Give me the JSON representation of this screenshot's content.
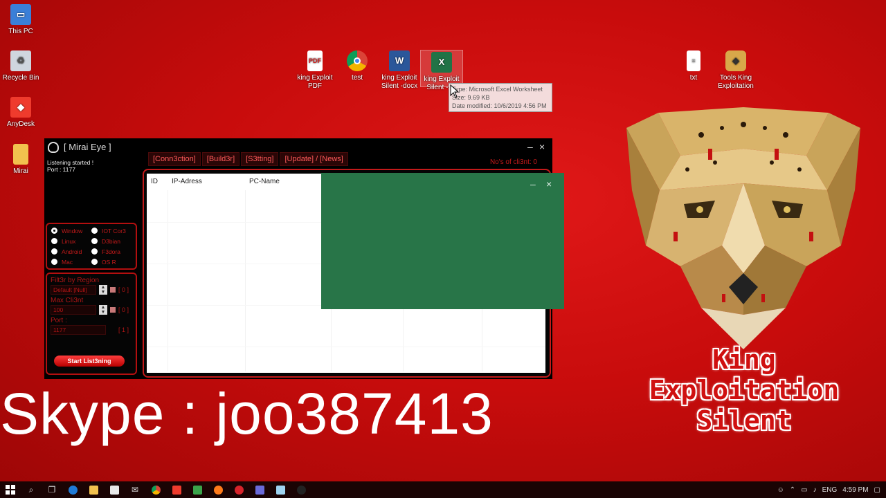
{
  "desktop": {
    "left_icons": [
      {
        "label": "This PC",
        "icon": "computer-icon"
      },
      {
        "label": "Recycle Bin",
        "icon": "recycle-bin-icon"
      },
      {
        "label": "AnyDesk",
        "icon": "anydesk-icon"
      },
      {
        "label": "Mirai",
        "icon": "folder-icon"
      }
    ],
    "top_icons": [
      {
        "label": "king Exploit PDF",
        "icon": "pdf-icon"
      },
      {
        "label": "test",
        "icon": "chrome-icon"
      },
      {
        "label": "king Exploit Silent -docx",
        "icon": "word-icon"
      },
      {
        "label": "king Exploit Silent -xls",
        "icon": "excel-icon"
      },
      {
        "label": "txt",
        "icon": "text-file-icon"
      },
      {
        "label": "Tools King Exploitation",
        "icon": "cheetah-icon"
      }
    ],
    "tooltip": {
      "type": "Type: Microsoft Excel Worksheet",
      "size": "Size: 9.69 KB",
      "date": "Date modified: 10/6/2019 4:56 PM"
    }
  },
  "app": {
    "title": "[ Mirai Eye ]",
    "status_line1": "Listening started !",
    "status_line2": "Port : 1177",
    "clients_label": "No's of cli3nt: 0",
    "tabs": [
      "[Conn3ction]",
      "[Build3r]",
      "[S3tting]",
      "[Update] / [News]"
    ],
    "os_options": [
      {
        "label": "Window",
        "selected": true
      },
      {
        "label": "IOT Cor3",
        "selected": false
      },
      {
        "label": "Linux",
        "selected": false
      },
      {
        "label": "D3bian",
        "selected": false
      },
      {
        "label": "Android",
        "selected": false
      },
      {
        "label": "F3dora",
        "selected": false
      },
      {
        "label": "Mac",
        "selected": false
      },
      {
        "label": "OS R",
        "selected": false
      }
    ],
    "filter_label": "Filt3r by Region",
    "filter_value": "Default [Null]",
    "filter_count": "[ 0 ]",
    "max_label": "Max Cli3nt",
    "max_value": "100",
    "max_count": "[ 0 ]",
    "port_label": "Port :",
    "port_value": "1177",
    "port_count": "[ 1 ]",
    "start_button": "Start List3ning",
    "grid_headers": [
      "ID",
      "IP-Adress",
      "PC-Name"
    ],
    "minimize": "–",
    "close": "×"
  },
  "overlay": {
    "minimize": "–",
    "close": "×",
    "color": "#287548"
  },
  "branding": {
    "line1": "King",
    "line2": "Exploitation",
    "line3": "Silent",
    "skype": "Skype : joo387413"
  },
  "taskbar": {
    "language": "ENG",
    "time": "4:59 PM"
  }
}
